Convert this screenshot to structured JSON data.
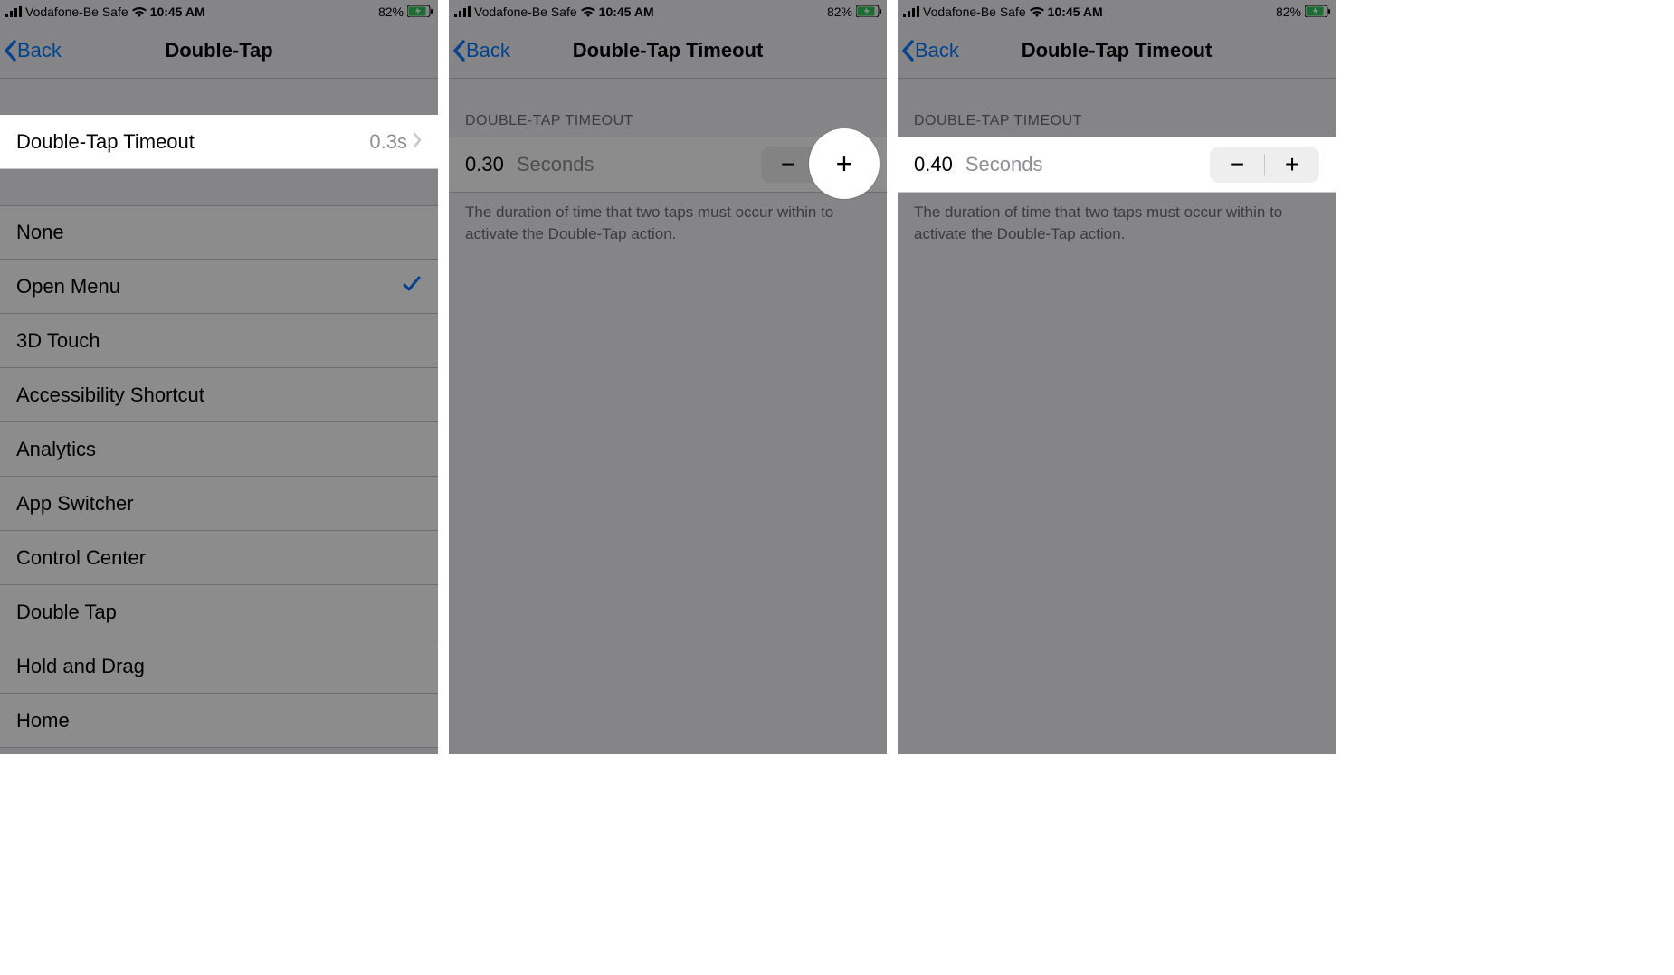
{
  "status": {
    "carrier": "Vodafone-Be Safe",
    "time": "10:45 AM",
    "battery_pct": "82%"
  },
  "screen1": {
    "back": "Back",
    "title": "Double-Tap",
    "timeout_row": {
      "label": "Double-Tap Timeout",
      "value": "0.3s"
    },
    "actions": [
      {
        "label": "None",
        "selected": false
      },
      {
        "label": "Open Menu",
        "selected": true
      },
      {
        "label": "3D Touch",
        "selected": false
      },
      {
        "label": "Accessibility Shortcut",
        "selected": false
      },
      {
        "label": "Analytics",
        "selected": false
      },
      {
        "label": "App Switcher",
        "selected": false
      },
      {
        "label": "Control Center",
        "selected": false
      },
      {
        "label": "Double Tap",
        "selected": false
      },
      {
        "label": "Hold and Drag",
        "selected": false
      },
      {
        "label": "Home",
        "selected": false
      }
    ]
  },
  "screen2": {
    "back": "Back",
    "title": "Double-Tap Timeout",
    "section_header": "DOUBLE-TAP TIMEOUT",
    "value": "0.30",
    "unit": "Seconds",
    "footer": "The duration of time that two taps must occur within to activate the Double-Tap action."
  },
  "screen3": {
    "back": "Back",
    "title": "Double-Tap Timeout",
    "section_header": "DOUBLE-TAP TIMEOUT",
    "value": "0.40",
    "unit": "Seconds",
    "footer": "The duration of time that two taps must occur within to activate the Double-Tap action."
  },
  "icons": {
    "minus": "−",
    "plus": "+"
  }
}
